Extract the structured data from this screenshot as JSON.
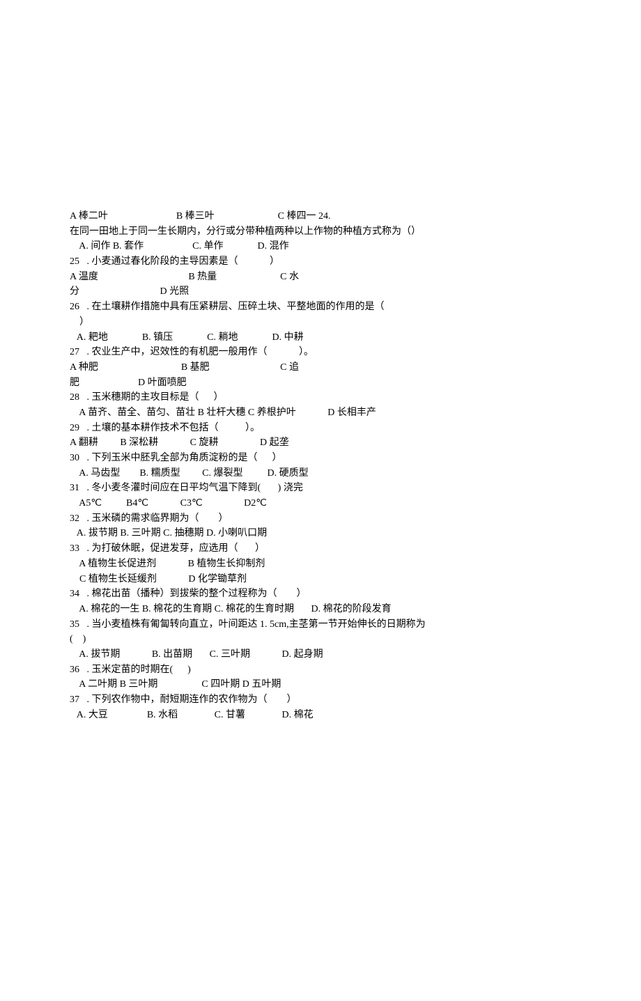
{
  "lines": [
    "A 棒二叶                            B 棒三叶                          C 棒四一 24.",
    "在同一田地上于同一生长期内，分行或分带种植两种以上作物的种植方式称为（）",
    "    A. 间作 B. 套作                    C. 单作              D. 混作",
    "25   . 小麦通过春化阶段的主导因素是（             ）",
    "A 温度                                     B 热量                          C 水",
    "分                                 D 光照",
    "26   . 在土壤耕作措施中具有压紧耕层、压碎土块、平整地面的作用的是（",
    "    ）",
    "   A. 耙地              B. 镇压              C. 耥地              D. 中耕",
    "27   . 农业生产中，迟效性的有机肥一般用作（             ）。",
    "A 种肥                                  B 基肥                             C 追",
    "肥                        D 叶面喷肥",
    "28   . 玉米穗期的主攻目标是（      ）",
    "    A 苗齐、苗全、苗匀、苗壮 B 壮杆大穗 C 养根护叶             D 长相丰产",
    "29   . 土壤的基本耕作技术不包括（           ）。",
    "A 翻耕         B 深松耕             C 旋耕                 D 起垄",
    "30   . 下列玉米中胚乳全部为角质淀粉的是（      ）",
    "    A. 马齿型        B. 糯质型         C. 爆裂型          D. 硬质型",
    "31   . 冬小麦冬灌时间应在日平均气温下降到(       ) 浇完",
    "    A5℃          B4℃             C3℃                 D2℃",
    "32   . 玉米磷的需求临界期为（        ）",
    "   A. 拔节期 B. 三叶期 C. 抽穗期 D. 小喇叭口期",
    "33   . 为打破休眠，促进发芽，应选用（       ）",
    "    A 植物生长促进剂             B 植物生长抑制剂",
    "    C 植物生长延缓剂             D 化学锄草剂",
    "34   . 棉花出苗（播种）到拔柴的整个过程称为（        ）",
    "    A. 棉花的一生 B. 棉花的生育期 C. 棉花的生育时期       D. 棉花的阶段发育",
    "35   . 当小麦植株有匍匐转向直立，叶间距达 1. 5cm,主茎第一节开始伸长的日期称为",
    "(    )",
    "    A. 拔节期             B. 出苗期       C. 三叶期             D. 起身期",
    "36   . 玉米定苗的时期在(      )",
    "    A 二叶期 B 三叶期                  C 四叶期 D 五叶期",
    "37   . 下列农作物中，耐短期连作的农作物为（        ）",
    "   A. 大豆                B. 水稻               C. 甘薯               D. 棉花"
  ]
}
